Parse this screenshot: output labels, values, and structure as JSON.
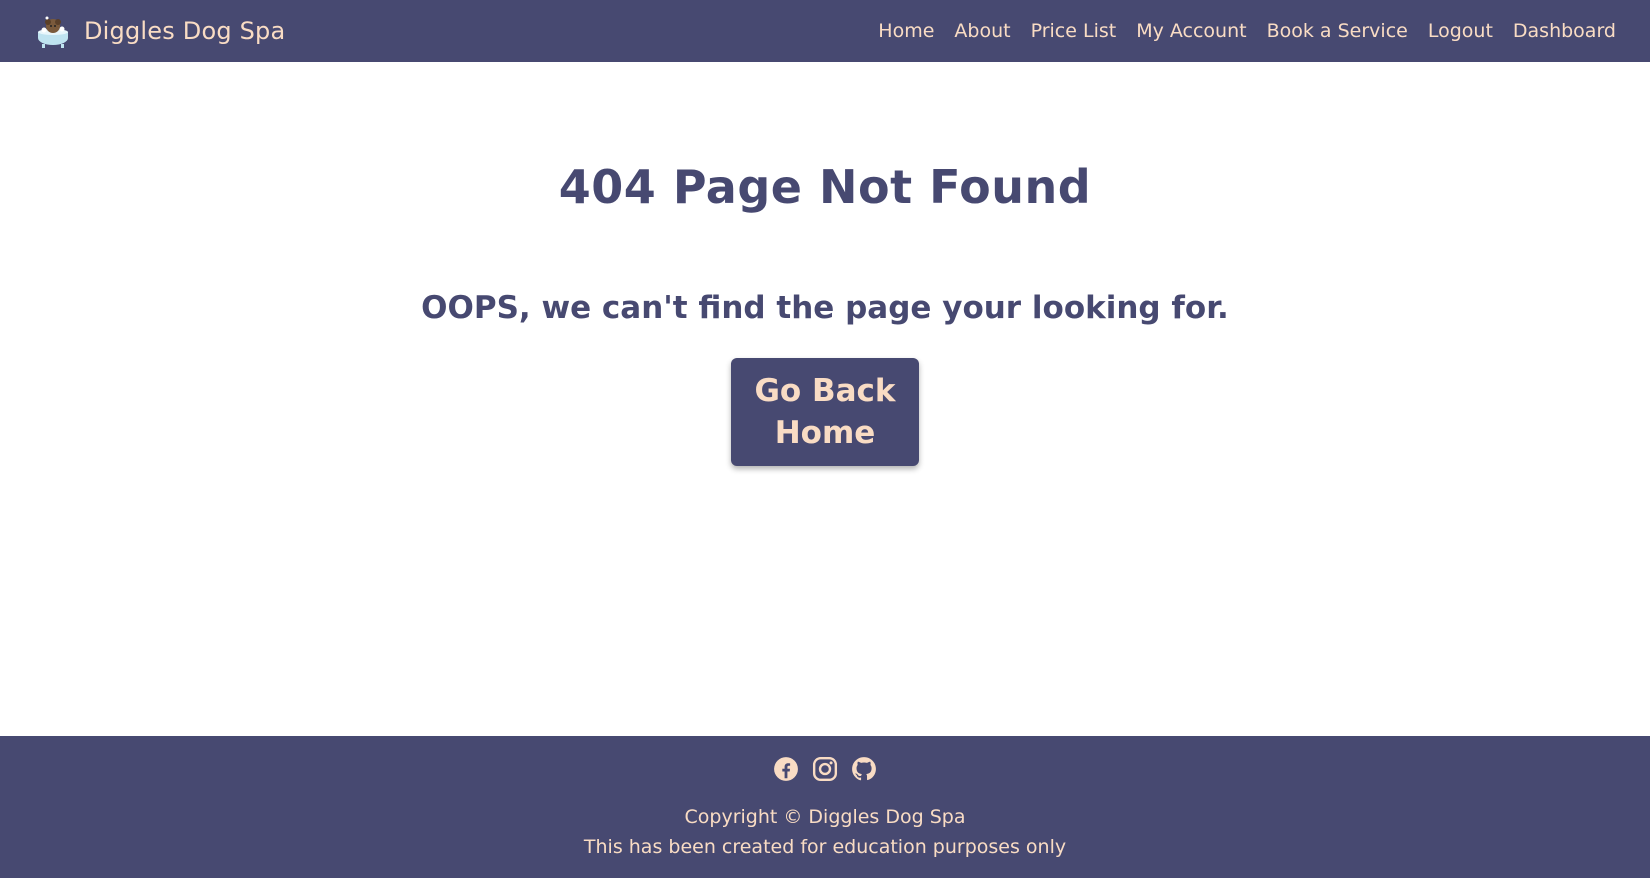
{
  "nav": {
    "brand": "Diggles Dog Spa",
    "links": [
      "Home",
      "About",
      "Price List",
      "My Account",
      "Book a Service",
      "Logout",
      "Dashboard"
    ]
  },
  "main": {
    "title": "404 Page Not Found",
    "subtitle": "OOPS, we can't find the page your looking for.",
    "button": "Go Back Home"
  },
  "footer": {
    "socials": [
      "facebook-icon",
      "instagram-icon",
      "github-icon"
    ],
    "copyright": "Copyright © Diggles Dog Spa",
    "note": "This has been created for education purposes only"
  },
  "colors": {
    "primary": "#474971",
    "accent": "#f9dcc4",
    "background": "#ffffff"
  }
}
